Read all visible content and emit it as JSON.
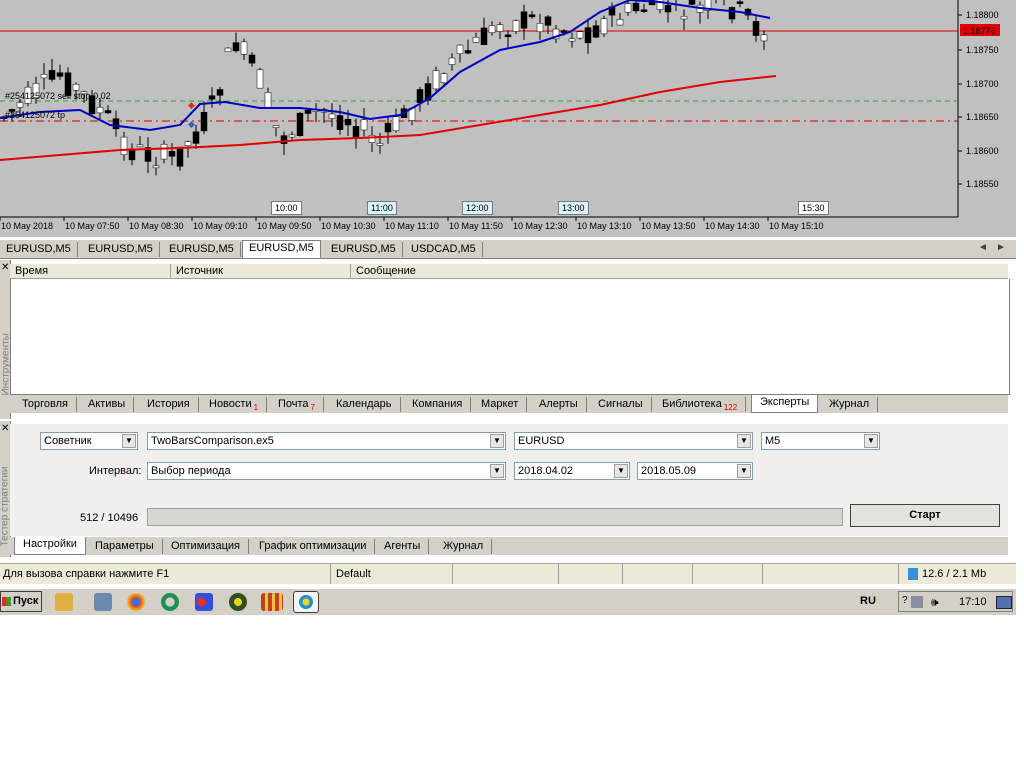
{
  "chart": {
    "price_ticks": [
      "1.18800",
      "1.18750",
      "1.18700",
      "1.18650",
      "1.18600",
      "1.18550"
    ],
    "current_price": "1.18776",
    "order_label_1": "#254125072 sell stop 0.02",
    "order_label_2": "#254125072 tp",
    "time_ticks": [
      "10 May 2018",
      "10 May 07:50",
      "10 May 08:30",
      "10 May 09:10",
      "10 May 09:50",
      "10 May 10:30",
      "10 May 11:10",
      "10 May 11:50",
      "10 May 12:30",
      "10 May 13:10",
      "10 May 13:50",
      "10 May 14:30",
      "10 May 15:10"
    ],
    "time_labels": [
      "10:00",
      "11:00",
      "12:00",
      "13:00",
      "15:30"
    ],
    "colors": {
      "background": "#c0c0c0",
      "candle_bull": "#ffffff",
      "candle_bear": "#000000",
      "ma_fast": "#0000c0",
      "ma_slow": "#e00000",
      "price_line": "#e00000",
      "order_line": "#30a030"
    }
  },
  "chart_tabs": [
    "EURUSD,M5",
    "EURUSD,M5",
    "EURUSD,M5",
    "EURUSD,M5",
    "EURUSD,M5",
    "USDCAD,M5"
  ],
  "toolbox": {
    "side_label": "Инструменты",
    "columns": [
      "Время",
      "Источник",
      "Сообщение"
    ],
    "tabs": [
      {
        "label": "Торговля",
        "badge": ""
      },
      {
        "label": "Активы",
        "badge": ""
      },
      {
        "label": "История",
        "badge": ""
      },
      {
        "label": "Новости",
        "badge": "1"
      },
      {
        "label": "Почта",
        "badge": "7"
      },
      {
        "label": "Календарь",
        "badge": ""
      },
      {
        "label": "Компания",
        "badge": ""
      },
      {
        "label": "Маркет",
        "badge": ""
      },
      {
        "label": "Алерты",
        "badge": ""
      },
      {
        "label": "Сигналы",
        "badge": ""
      },
      {
        "label": "Библиотека",
        "badge": "122"
      },
      {
        "label": "Эксперты",
        "badge": ""
      },
      {
        "label": "Журнал",
        "badge": ""
      }
    ]
  },
  "tester": {
    "side_label": "Тестер стратегии",
    "type_value": "Советник",
    "expert_value": "TwoBarsComparison.ex5",
    "symbol_value": "EURUSD",
    "period_value": "M5",
    "interval_label": "Интервал:",
    "interval_value": "Выбор периода",
    "date_from": "2018.04.02",
    "date_to": "2018.05.09",
    "progress_text": "512 / 10496",
    "progress_fraction": 0,
    "start_label": "Старт",
    "tabs": [
      "Настройки",
      "Параметры",
      "Оптимизация",
      "График оптимизации",
      "Агенты",
      "Журнал"
    ]
  },
  "statusbar": {
    "help": "Для вызова справки нажмите F1",
    "profile": "Default",
    "traffic": "12.6 / 2.1 Mb"
  },
  "taskbar": {
    "start_label": "Пуск",
    "lang": "RU",
    "clock": "17:10"
  }
}
